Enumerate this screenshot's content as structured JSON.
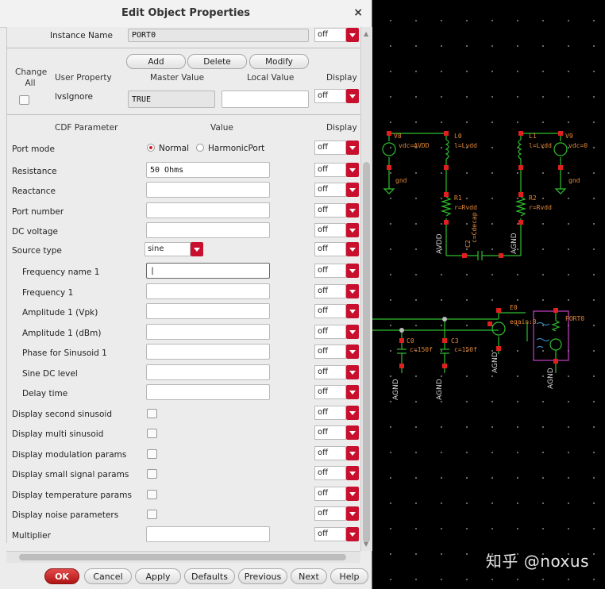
{
  "dialog": {
    "title": "Edit Object Properties",
    "close_glyph": "×"
  },
  "instance": {
    "label": "Instance Name",
    "value": "PORT0",
    "display": "off"
  },
  "user_props": {
    "add": "Add",
    "delete": "Delete",
    "modify": "Modify",
    "col_change": "Change All",
    "col_user": "User Property",
    "col_master": "Master Value",
    "col_local": "Local Value",
    "col_display": "Display",
    "row": {
      "name": "lvsIgnore",
      "master": "TRUE",
      "local": "",
      "display": "off"
    }
  },
  "cdf": {
    "col_param": "CDF Parameter",
    "col_value": "Value",
    "col_display": "Display",
    "port_mode": {
      "label": "Port mode",
      "opt1": "Normal",
      "opt2": "HarmonicPort",
      "selected": "Normal",
      "display": "off"
    },
    "resistance": {
      "label": "Resistance",
      "value": "50 Ohms",
      "display": "off"
    },
    "reactance": {
      "label": "Reactance",
      "value": "",
      "display": "off"
    },
    "port_number": {
      "label": "Port number",
      "value": "",
      "display": "off"
    },
    "dc_voltage": {
      "label": "DC voltage",
      "value": "",
      "display": "off"
    },
    "source_type": {
      "label": "Source type",
      "value": "sine",
      "display": "off"
    },
    "freq_name1": {
      "label": "Frequency name 1",
      "value": "|",
      "display": "off"
    },
    "freq1": {
      "label": "Frequency 1",
      "value": "",
      "display": "off"
    },
    "amp1_vpk": {
      "label": "Amplitude 1 (Vpk)",
      "value": "",
      "display": "off"
    },
    "amp1_dbm": {
      "label": "Amplitude 1 (dBm)",
      "value": "",
      "display": "off"
    },
    "phase1": {
      "label": "Phase for Sinusoid 1",
      "value": "",
      "display": "off"
    },
    "sine_dc": {
      "label": "Sine DC level",
      "value": "",
      "display": "off"
    },
    "delay": {
      "label": "Delay time",
      "value": "",
      "display": "off"
    },
    "disp_second": {
      "label": "Display second sinusoid",
      "display": "off"
    },
    "disp_multi": {
      "label": "Display multi sinusoid",
      "display": "off"
    },
    "disp_mod": {
      "label": "Display modulation params",
      "display": "off"
    },
    "disp_small": {
      "label": "Display small signal params",
      "display": "off"
    },
    "disp_temp": {
      "label": "Display temperature params",
      "display": "off"
    },
    "disp_noise": {
      "label": "Display noise parameters",
      "display": "off"
    },
    "multiplier": {
      "label": "Multiplier",
      "value": "",
      "display": "off"
    }
  },
  "buttons": {
    "ok": "OK",
    "cancel": "Cancel",
    "apply": "Apply",
    "defaults": "Defaults",
    "previous": "Previous",
    "next": "Next",
    "help": "Help"
  },
  "schematic": {
    "labels": {
      "v8": "V8",
      "vdc_avdd": "vdc=AVDD",
      "l0": "L0",
      "l_lvdd0": "l=Lvdd",
      "l1": "L1",
      "l_lvdd1": "l=Lvdd",
      "v9": "V9",
      "vdc_zero": "vdc=0",
      "gnd_l": "gnd",
      "gnd_r": "gnd",
      "r1": "R1",
      "r_rvdd1": "r=Rvdd",
      "r2": "R2",
      "r_rvdd2": "r=Rvdd",
      "c2": "C2",
      "c_cdecap": "c=Cdecap",
      "avdd": "AVDD",
      "agnd_top": "AGND",
      "e0": "E0",
      "egain": "egain:0",
      "port0": "PORT0",
      "c0": "C0",
      "c_150f_0": "c=150f",
      "c3": "C3",
      "c_150f_3": "c=150f",
      "agnd1": "AGND",
      "agnd2": "AGND",
      "agnd3": "AGND",
      "agnd4": "AGND",
      "left_edge": "AVDD"
    },
    "watermark": "知乎 @noxus"
  }
}
